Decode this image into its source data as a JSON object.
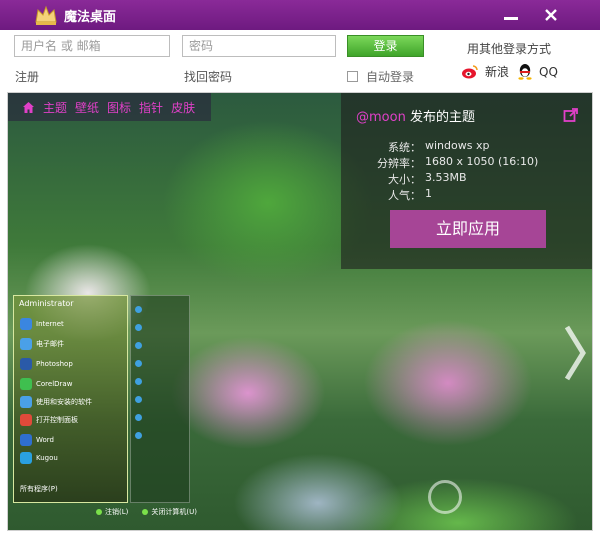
{
  "app": {
    "title": "魔法桌面"
  },
  "login": {
    "username_placeholder": "用户名 或 邮箱",
    "password_placeholder": "密码",
    "login_label": "登录",
    "register_label": "注册",
    "forgot_label": "找回密码",
    "auto_login_label": "自动登录",
    "auto_login_checked": false,
    "other_methods_label": "用其他登录方式",
    "weibo_label": "新浪",
    "qq_label": "QQ"
  },
  "nav": {
    "items": [
      "主题",
      "壁纸",
      "图标",
      "指针",
      "皮肤"
    ]
  },
  "theme": {
    "author": "@moon",
    "published_label": "发布的主题",
    "specs": [
      {
        "key": "系统：",
        "value": "windows xp"
      },
      {
        "key": "分辨率：",
        "value": "1680 x 1050 (16:10)"
      },
      {
        "key": "大小：",
        "value": "3.53MB"
      },
      {
        "key": "人气：",
        "value": "1"
      }
    ],
    "apply_label": "立即应用"
  },
  "startmenu": {
    "user": "Administrator",
    "entries": [
      "Internet",
      "电子邮件",
      "Photoshop",
      "CorelDraw",
      "使用和安装的软件",
      "打开控制面板",
      "Word",
      "Kugou"
    ],
    "all_programs": "所有程序(P)",
    "logoff": "注销(L)",
    "shutdown": "关闭计算机(U)"
  },
  "colors": {
    "accent": "#8a2a98",
    "link_pink": "#e040c8",
    "apply_bg": "#a64596",
    "login_green": "#3fa42a"
  },
  "icons": [
    "crown-logo-icon",
    "minimize-icon",
    "close-icon",
    "home-icon",
    "share-icon",
    "weibo-icon",
    "qq-icon",
    "next-arrow-icon"
  ]
}
